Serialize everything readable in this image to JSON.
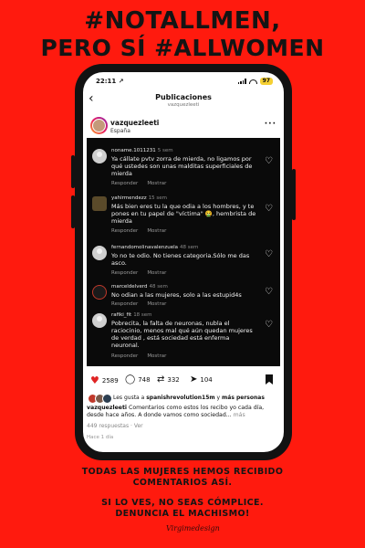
{
  "poster": {
    "headline_line1": "#NOTALLMEN,",
    "headline_line2": "PERO SÍ #ALLWOMEN",
    "footer_line1": "TODAS LAS MUJERES HEMOS RECIBIDO",
    "footer_line2": "COMENTARIOS ASÍ.",
    "footer_line3": "SI LO VES, NO SEAS CÓMPLICE.",
    "footer_line4": "DENUNCIA EL MACHISMO!",
    "signature": "Virgimedesign",
    "background_color": "#ff1a0e"
  },
  "status_bar": {
    "time": "22:11",
    "time_arrow": "↗",
    "battery": "97"
  },
  "nav": {
    "back_icon": "chevron-left-icon",
    "back_glyph": "‹",
    "title": "Publicaciones",
    "subtitle": "vazquezleeti"
  },
  "post": {
    "username": "vazquezleeti",
    "location": "España",
    "more_glyph": "···"
  },
  "comments": [
    {
      "username": "noname.1011231",
      "ago": "5 sem",
      "text": "Ya cállate pvtv zorra de mierda, no ligamos por qué ustedes son unas malditas superficiales de mierda",
      "reply": "Responder",
      "show": "Mostrar"
    },
    {
      "username": "yahirmendezz",
      "ago": "15 sem",
      "text": "Más bien eres tu la que odia a los hombres, y te pones en tu papel de \"víctima\" 🤮, hembrista de mierda",
      "reply": "Responder",
      "show": "Mostrar"
    },
    {
      "username": "fernandomolinavalenzuela",
      "ago": "48 sem",
      "text": "Yo no te odio. No tienes categoria.Sólo me das asco.",
      "reply": "Responder",
      "show": "Mostrar"
    },
    {
      "username": "marceldelverd",
      "ago": "48 sem",
      "text": "No odian a las mujeres, solo a las estupid4s",
      "reply": "Responder",
      "show": "Mostrar"
    },
    {
      "username": "rafiki_fit",
      "ago": "18 sem",
      "text": "Pobrecita, la falta de neuronas, nubla el raciocinio, menos mal qué aún quedan mujeres de verdad , está sociedad está enferma neuronal.",
      "reply": "Responder",
      "show": "Mostrar"
    }
  ],
  "actions": {
    "likes": "2589",
    "comments": "748",
    "reposts": "332",
    "shares": "104"
  },
  "likes_line": {
    "prefix": "Les gusta a ",
    "user": "spanishrevolution15m",
    "middle": " y ",
    "suffix": "más personas"
  },
  "caption": {
    "username": "vazquezleeti",
    "text": " Comentarios como estos los recibo yo cada día, desde hace años. A donde vamos como sociedad...",
    "more": " más"
  },
  "replies": {
    "count_text": "449 respuestas",
    "see": "Ver"
  },
  "date": "Hace 1 día"
}
